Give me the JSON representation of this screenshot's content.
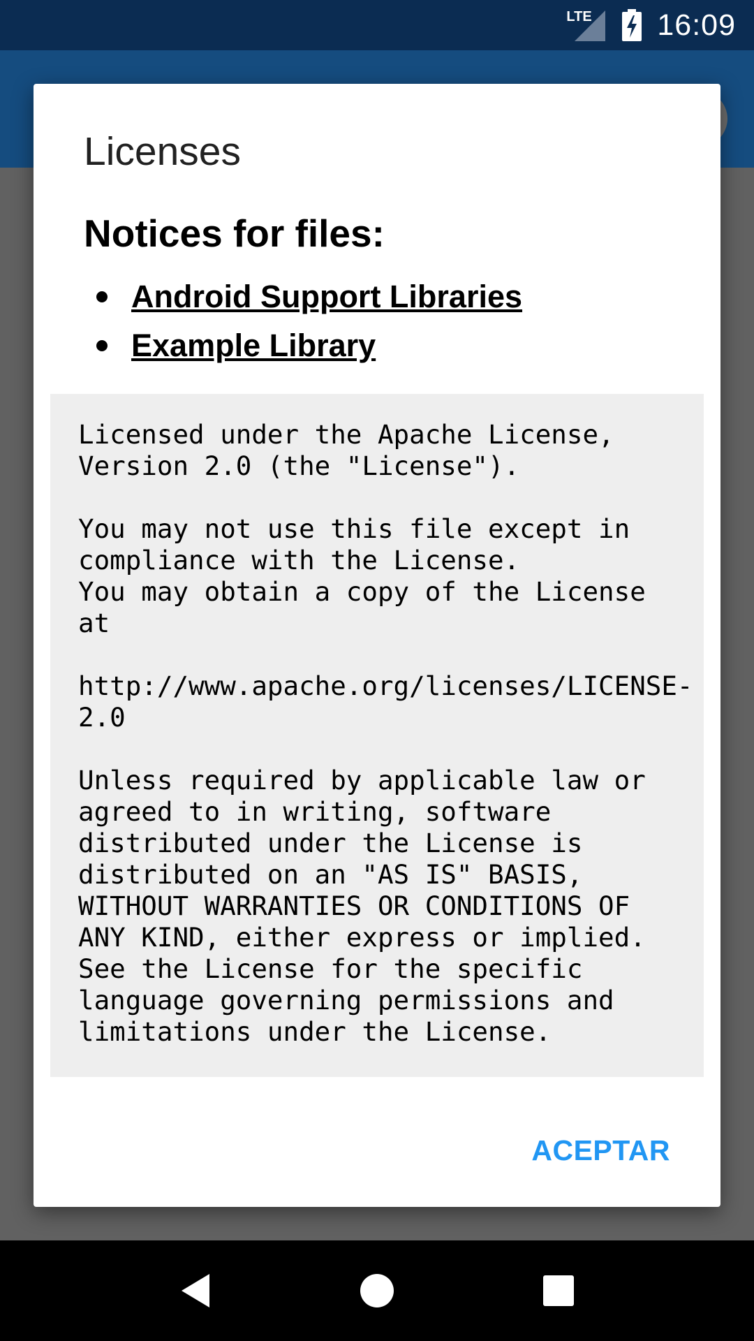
{
  "status_bar": {
    "network": "LTE",
    "time": "16:09",
    "icons": [
      "lte-signal-icon",
      "battery-charging-icon"
    ]
  },
  "dialog": {
    "title": "Licenses",
    "notices_heading": "Notices for files:",
    "notices": [
      {
        "label": "Android Support Libraries"
      },
      {
        "label": "Example Library"
      }
    ],
    "license_text": "Licensed under the Apache License,\nVersion 2.0 (the \"License\").\n\nYou may not use this file except in\ncompliance with the License.\nYou may obtain a copy of the License\nat\n\nhttp://www.apache.org/licenses/LICENSE-\n2.0\n\nUnless required by applicable law or\nagreed to in writing, software\ndistributed under the License is\ndistributed on an \"AS IS\" BASIS,\nWITHOUT WARRANTIES OR CONDITIONS OF\nANY KIND, either express or implied.\nSee the License for the specific\nlanguage governing permissions and\nlimitations under the License.",
    "accept_label": "ACEPTAR"
  },
  "nav_bar": {
    "icons": [
      "back-icon",
      "home-icon",
      "recents-icon"
    ]
  },
  "colors": {
    "status_bar": "#0b2c52",
    "app_bar": "#154c7f",
    "scrim": "#616161",
    "accent": "#2196f3",
    "license_bg": "#eeeeee"
  }
}
